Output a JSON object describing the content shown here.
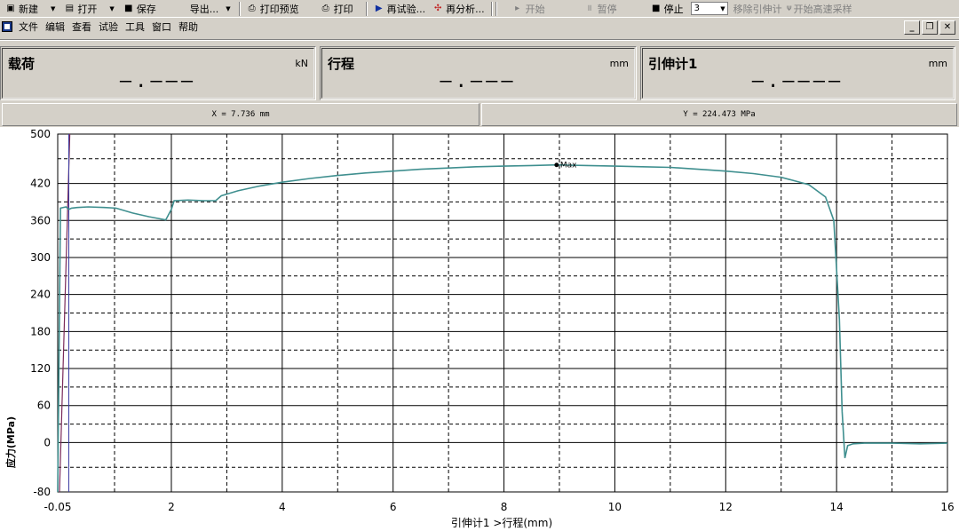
{
  "toolbar": {
    "new_label": "新建",
    "open_label": "打开",
    "save_label": "保存",
    "export_label": "导出...",
    "print_preview_label": "打印预览",
    "print_label": "打印",
    "retest_label": "再试验...",
    "reanalyze_label": "再分析...",
    "start_label": "开始",
    "pause_label": "暂停",
    "stop_label": "停止",
    "combo_value": "3",
    "remove_extensometer_label": "移除引伸计",
    "high_speed_label": "开始高速采样"
  },
  "menu": {
    "items": [
      "文件",
      "编辑",
      "查看",
      "试验",
      "工具",
      "窗口",
      "帮助"
    ]
  },
  "panels": [
    {
      "title": "载荷",
      "unit": "kN",
      "value": "—.———"
    },
    {
      "title": "行程",
      "unit": "mm",
      "value": "—.———"
    },
    {
      "title": "引伸计1",
      "unit": "mm",
      "value": "—.————"
    }
  ],
  "coords": {
    "x_readout": "X = 7.736 mm",
    "y_readout": "Y = 224.473 MPa"
  },
  "chart_data": {
    "type": "line",
    "xlabel": "引伸计1 >行程(mm)",
    "ylabel": "应力(MPa)",
    "xlim": [
      -0.05,
      16
    ],
    "ylim": [
      -80,
      500
    ],
    "x_ticks": [
      "-0.05",
      "2",
      "4",
      "6",
      "8",
      "10",
      "12",
      "14",
      "16"
    ],
    "y_ticks": [
      "500",
      "420",
      "360",
      "300",
      "240",
      "180",
      "120",
      "60",
      "0",
      "-80"
    ],
    "grid": true,
    "line_color": "#3f8f8f",
    "annotation": {
      "label": "Max",
      "x": 8.95,
      "y": 450
    },
    "series": [
      {
        "x": [
          -0.05,
          0.0,
          0.1,
          0.15,
          0.2,
          0.3,
          0.5,
          0.8,
          1.0,
          1.3,
          1.6,
          1.9,
          2.0,
          2.05,
          2.3,
          2.6,
          2.8,
          2.9,
          3.2,
          3.6,
          4.0,
          4.5,
          5.0,
          5.5,
          6.0,
          6.5,
          7.0,
          7.5,
          8.0,
          8.5,
          8.95,
          9.5,
          10.0,
          10.5,
          11.0,
          11.5,
          12.0,
          12.5,
          13.0,
          13.5,
          13.8,
          13.95,
          14.05,
          14.1,
          14.15,
          14.2,
          14.3,
          14.5,
          15.0,
          15.5,
          16.0
        ],
        "y": [
          -80,
          380,
          382,
          378,
          380,
          381,
          382,
          381,
          380,
          372,
          366,
          361,
          378,
          392,
          393,
          392,
          392,
          400,
          408,
          416,
          422,
          428,
          433,
          437,
          440,
          443,
          445,
          447,
          448,
          449,
          450,
          449,
          448,
          447,
          446,
          443,
          440,
          436,
          430,
          418,
          398,
          360,
          200,
          50,
          -25,
          -5,
          -2,
          -1,
          -1,
          -2,
          -1
        ]
      }
    ]
  }
}
